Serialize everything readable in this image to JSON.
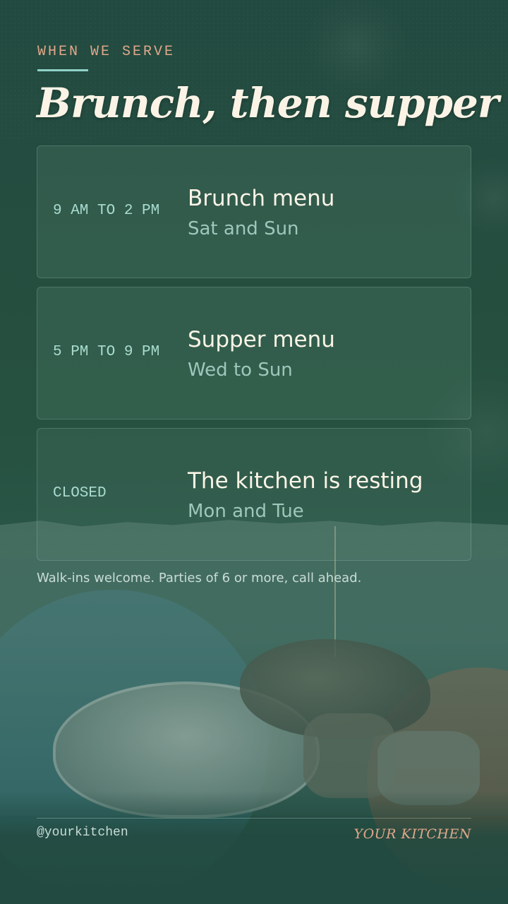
{
  "header": {
    "eyebrow": "WHEN WE SERVE",
    "title": "Brunch, then supper"
  },
  "schedule": [
    {
      "time": "9 AM TO 2 PM",
      "name": "Brunch menu",
      "days": "Sat and Sun"
    },
    {
      "time": "5 PM TO 9 PM",
      "name": "Supper menu",
      "days": "Wed to Sun"
    },
    {
      "time": "CLOSED",
      "name": "The kitchen is resting",
      "days": "Mon and Tue"
    }
  ],
  "note": "Walk-ins welcome. Parties of 6 or more, call ahead.",
  "footer": {
    "handle": "@yourkitchen",
    "brand": "YOUR KITCHEN"
  },
  "colors": {
    "background": "#234a40",
    "accent": "#e0a88a",
    "rule": "#8fd3c9",
    "title": "#fbf4e6"
  }
}
